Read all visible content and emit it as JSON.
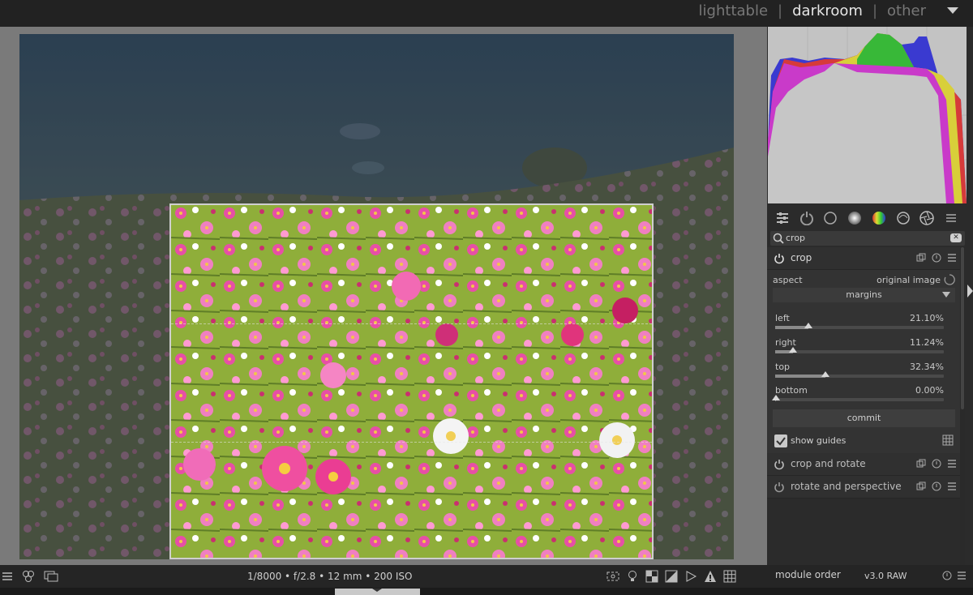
{
  "header": {
    "views": [
      "lighttable",
      "darkroom",
      "other"
    ],
    "active_view": "darkroom",
    "separator": "|"
  },
  "modules": {
    "search": {
      "value": "crop"
    },
    "crop": {
      "name": "crop",
      "aspect_label": "aspect",
      "aspect_value": "original image",
      "section": "margins",
      "sliders": [
        {
          "label": "left",
          "value": "21.10%",
          "fraction": 0.211
        },
        {
          "label": "right",
          "value": "11.24%",
          "fraction": 0.1124
        },
        {
          "label": "top",
          "value": "32.34%",
          "fraction": 0.3234
        },
        {
          "label": "bottom",
          "value": "0.00%",
          "fraction": 0.0
        }
      ],
      "commit_label": "commit",
      "show_guides_label": "show guides",
      "show_guides_checked": true
    },
    "others": [
      {
        "name": "crop and rotate"
      },
      {
        "name": "rotate and perspective"
      }
    ]
  },
  "bottom": {
    "exif": "1/8000 • f/2.8 • 12 mm • 200 ISO",
    "module_order_label": "module order",
    "module_order_value": "v3.0 RAW"
  },
  "colors": {
    "accent": "#cfcfcf",
    "panel_bg": "#2b2b2b",
    "histogram_bg": "#c3c3c3"
  }
}
